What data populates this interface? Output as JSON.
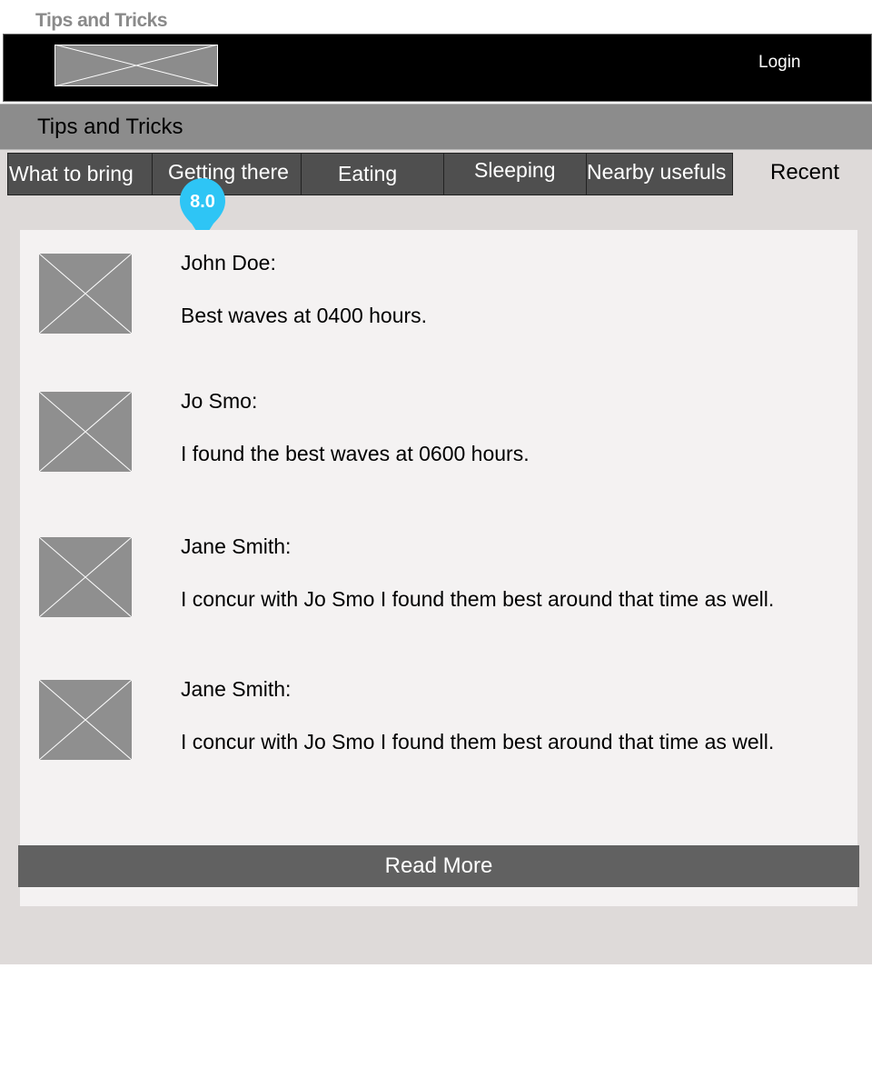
{
  "page_label": "Tips and Tricks",
  "header": {
    "logo": "image-placeholder",
    "login_label": "Login"
  },
  "subheader": {
    "title": "Tips and Tricks"
  },
  "tabs": [
    {
      "label": "What to bring"
    },
    {
      "label": "Getting there"
    },
    {
      "label": "Eating"
    },
    {
      "label": "Sleeping"
    },
    {
      "label": "Nearby usefuls"
    },
    {
      "label": "Recent"
    }
  ],
  "pin": {
    "label": "8.0",
    "color": "#2ec5f5"
  },
  "comments": [
    {
      "author": "John Doe:",
      "message": "Best waves at 0400 hours."
    },
    {
      "author": "Jo Smo:",
      "message": "I found the best waves at 0600 hours."
    },
    {
      "author": "Jane Smith:",
      "message": "I concur with Jo Smo I found them best around that time as well."
    },
    {
      "author": "Jane Smith:",
      "message": "I concur with Jo Smo I found them best around that time as well."
    }
  ],
  "read_more_label": "Read More",
  "colors": {
    "header_bg": "#000000",
    "subheader_bg": "#8c8c8c",
    "tab_bg": "#4f4f4f",
    "page_bg": "#dedad9",
    "panel_bg": "#f4f2f2",
    "button_bg": "#616161"
  }
}
